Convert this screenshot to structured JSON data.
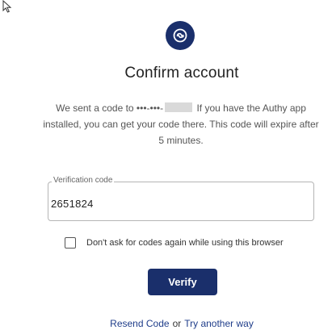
{
  "header": {
    "logo_icon": "authy-logo-icon",
    "title": "Confirm account"
  },
  "description": {
    "prefix": "We sent a code to •••-•••-",
    "masked_number": "",
    "line1_suffix": " If you have the Authy app",
    "line2": "installed, you can get your code there. This code will expire after",
    "line3": "5 minutes."
  },
  "verification": {
    "label": "Verification code",
    "value": "2651824"
  },
  "remember": {
    "label": "Don't ask for codes again while using this browser",
    "checked": false
  },
  "actions": {
    "verify_label": "Verify",
    "resend_label": "Resend Code",
    "or_text": "or",
    "try_another_label": "Try another way"
  },
  "colors": {
    "brand": "#1a2f6b",
    "link": "#1f3d8a"
  }
}
